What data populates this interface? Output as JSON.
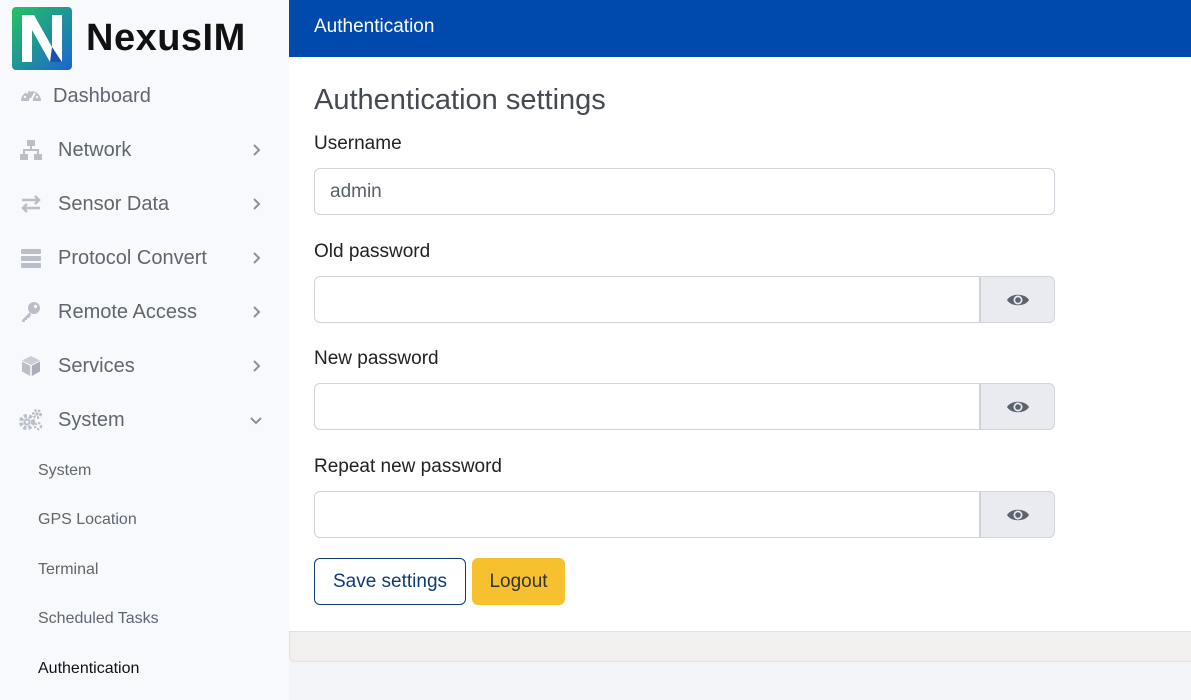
{
  "brand": {
    "name": "NexusIM"
  },
  "header": {
    "title": "Authentication"
  },
  "sidebar": {
    "items": [
      {
        "label": "Dashboard",
        "icon": "dashboard-gauge-icon"
      },
      {
        "label": "Network",
        "icon": "network-icon",
        "expandable": true
      },
      {
        "label": "Sensor Data",
        "icon": "exchange-arrows-icon",
        "expandable": true
      },
      {
        "label": "Protocol Convert",
        "icon": "server-stack-icon",
        "expandable": true
      },
      {
        "label": "Remote Access",
        "icon": "key-icon",
        "expandable": true
      },
      {
        "label": "Services",
        "icon": "cube-icon",
        "expandable": true
      },
      {
        "label": "System",
        "icon": "gears-icon",
        "expandable": true,
        "expanded": true
      }
    ],
    "subitems": [
      {
        "label": "System"
      },
      {
        "label": "GPS Location"
      },
      {
        "label": "Terminal"
      },
      {
        "label": "Scheduled Tasks"
      },
      {
        "label": "Authentication",
        "active": true
      }
    ]
  },
  "form": {
    "title": "Authentication settings",
    "username_label": "Username",
    "username_value": "admin",
    "old_password_label": "Old password",
    "old_password_value": "",
    "new_password_label": "New password",
    "new_password_value": "",
    "repeat_password_label": "Repeat new password",
    "repeat_password_value": "",
    "save_label": "Save settings",
    "logout_label": "Logout"
  },
  "colors": {
    "header_bg": "#004aad",
    "logout_bg": "#f6c02e",
    "save_border": "#0d3c78",
    "logo_green": "#22c55e",
    "logo_blue": "#1e64d2"
  }
}
